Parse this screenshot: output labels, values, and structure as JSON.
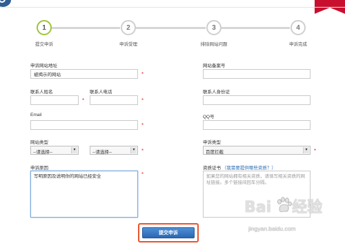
{
  "steps": [
    {
      "number": "1",
      "label": "提交申诉",
      "active": true
    },
    {
      "number": "2",
      "label": "申诉受理",
      "active": false
    },
    {
      "number": "3",
      "label": "排除网站问题",
      "active": false
    },
    {
      "number": "4",
      "label": "申诉完成",
      "active": false
    }
  ],
  "form": {
    "site_url": {
      "label": "申诉网站地址",
      "value": "被揭示的网站"
    },
    "icp": {
      "label": "网站备案号",
      "value": ""
    },
    "contact_name": {
      "label": "联系人姓名",
      "value": ""
    },
    "contact_phone": {
      "label": "联系人电话",
      "value": ""
    },
    "contact_id": {
      "label": "联系人身份证",
      "value": ""
    },
    "email": {
      "label": "Email",
      "value": ""
    },
    "qq": {
      "label": "QQ号",
      "value": ""
    },
    "site_type": {
      "label": "网站类型",
      "select1": "--请选择--",
      "select2": "--请选择--"
    },
    "appeal_type": {
      "label": "申诉类型",
      "value": "百度拦截"
    },
    "reason": {
      "label": "申诉原因",
      "value": "写明原因及说明你的网站已经安全"
    },
    "cert": {
      "label": "资质证书",
      "link": "（我需要提供哪些资质？）",
      "placeholder": "如果您的网站拥有相关资质，请填写相关资质的网址链接。多个链接间回车分隔。"
    },
    "submit_label": "提交申诉"
  },
  "watermark": {
    "logo_text": "Bai",
    "logo_suffix": "经验",
    "url": "jingyan.baidu.com"
  },
  "colors": {
    "accent_green": "#9ec33a",
    "required_red": "#e03030",
    "button_blue": "#2a67b3",
    "highlight_orange": "#e8532d"
  }
}
